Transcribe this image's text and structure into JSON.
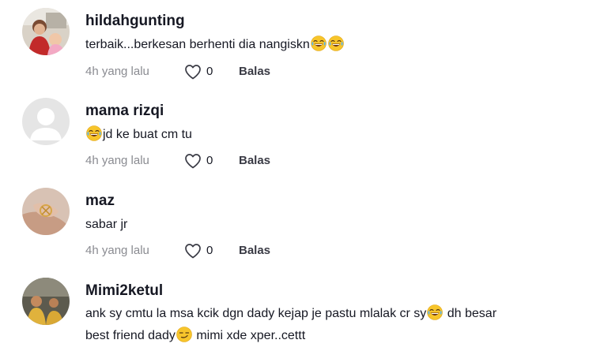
{
  "comments": [
    {
      "username": "hildahgunting",
      "text": "terbaik...berkesan berhenti dia nangiskn",
      "time": "4h yang lalu",
      "likes": "0",
      "reply": "Balas"
    },
    {
      "username": "mama rizqi",
      "text": "jd ke buat cm tu",
      "time": "4h yang lalu",
      "likes": "0",
      "reply": "Balas"
    },
    {
      "username": "maz",
      "text": "sabar jr",
      "time": "4h yang lalu",
      "likes": "0",
      "reply": "Balas"
    },
    {
      "username": "Mimi2ketul",
      "text_line1_part1": "ank sy cmtu la msa kcik dgn dady kejap je pastu mlalak cr sy",
      "text_line1_part2": "dh besar",
      "text_line2_part1": "best friend dady",
      "text_line2_part2": "mimi xde xper..cettt"
    }
  ],
  "icons": {
    "like": "heart-outline-icon",
    "laugh": "joy-emoji",
    "smirk": "smirk-emoji"
  },
  "colors": {
    "text": "#161823",
    "muted": "#8a8b91",
    "reply": "#3a3b45"
  }
}
